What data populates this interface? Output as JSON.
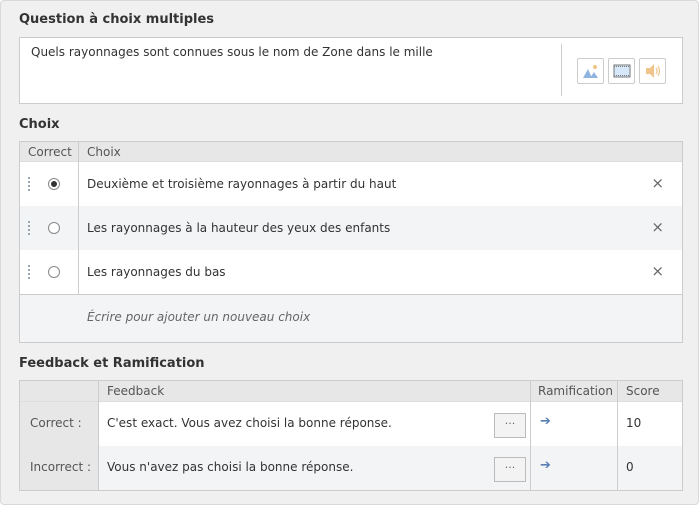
{
  "question_section": {
    "title": "Question à choix multiples",
    "question_text": "Quels rayonnages sont connues sous le nom  de Zone dans le mille",
    "media_buttons": [
      {
        "icon": "image-icon"
      },
      {
        "icon": "video-icon"
      },
      {
        "icon": "audio-icon"
      }
    ]
  },
  "choices_section": {
    "title": "Choix",
    "headers": {
      "correct": "Correct",
      "choice": "Choix"
    },
    "items": [
      {
        "text": "Deuxième et troisième rayonnages à partir du haut",
        "correct": true
      },
      {
        "text": "Les rayonnages à la hauteur des yeux des enfants",
        "correct": false
      },
      {
        "text": "Les rayonnages du bas",
        "correct": false
      }
    ],
    "delete_glyph": "×",
    "new_choice_placeholder": "Écrire pour ajouter un nouveau choix"
  },
  "feedback_section": {
    "title": "Feedback et Ramification",
    "headers": {
      "feedback": "Feedback",
      "branching": "Ramification",
      "score": "Score"
    },
    "rows": [
      {
        "label": "Correct :",
        "feedback": "C'est exact. Vous avez choisi la bonne réponse.",
        "more": "···",
        "arrow": "➔",
        "score": "10"
      },
      {
        "label": "Incorrect :",
        "feedback": "Vous n'avez pas choisi la bonne réponse.",
        "more": "···",
        "arrow": "➔",
        "score": "0"
      }
    ]
  },
  "colors": {
    "accent_arrow": "#5a7fb5",
    "image_icon": "#8fb4e0",
    "audio_icon": "#f0c48a"
  }
}
